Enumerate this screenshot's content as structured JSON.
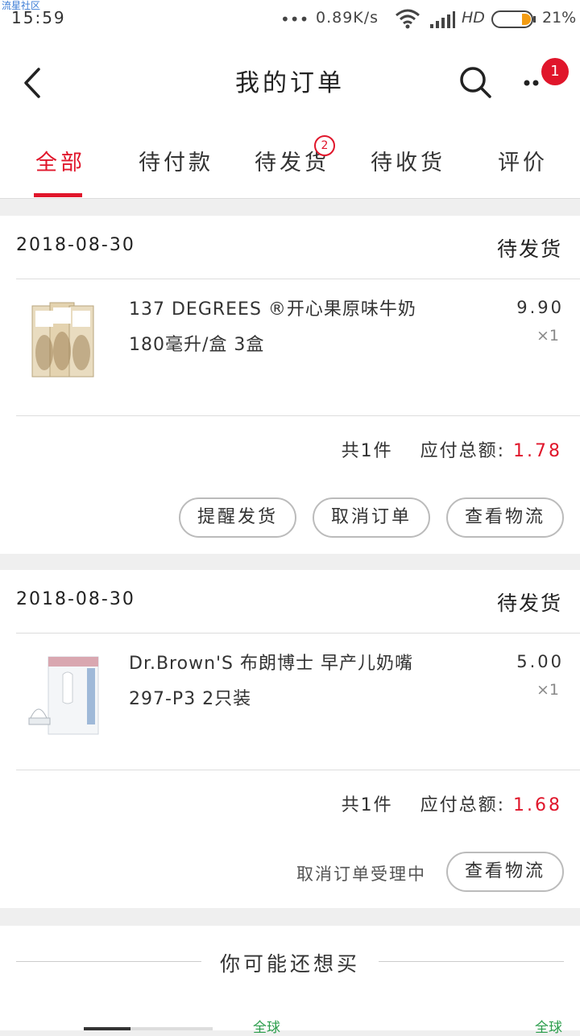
{
  "status_bar": {
    "watermark": "流星社区",
    "time": "15:59",
    "dots": "•••",
    "net_speed": "0.89K/s",
    "network": "HD",
    "battery_percent": "21%"
  },
  "header": {
    "title": "我的订单",
    "more_badge": "1"
  },
  "tabs": [
    {
      "label": "全部",
      "active": true
    },
    {
      "label": "待付款"
    },
    {
      "label": "待发货",
      "badge": "2"
    },
    {
      "label": "待收货"
    },
    {
      "label": "评价"
    }
  ],
  "orders": [
    {
      "date": "2018-08-30",
      "status": "待发货",
      "product_name": "137 DEGREES ®开心果原味牛奶",
      "product_spec": "180毫升/盒 3盒",
      "price": "9.90",
      "quantity": "×1",
      "count_text": "共1件",
      "total_label": "应付总额:",
      "total": "1.78",
      "buttons": [
        "提醒发货",
        "取消订单",
        "查看物流"
      ]
    },
    {
      "date": "2018-08-30",
      "status": "待发货",
      "product_name": "Dr.Brown'S 布朗博士 早产儿奶嘴",
      "product_spec": "297-P3 2只装",
      "price": "5.00",
      "quantity": "×1",
      "count_text": "共1件",
      "total_label": "应付总额:",
      "total": "1.68",
      "note": "取消订单受理中",
      "buttons": [
        "查看物流"
      ]
    }
  ],
  "recommend": {
    "title": "你可能还想买",
    "tag_left": "全球",
    "tag_right": "全球"
  },
  "colors": {
    "accent": "#e0162b",
    "tag_green": "#2a9d4b"
  }
}
